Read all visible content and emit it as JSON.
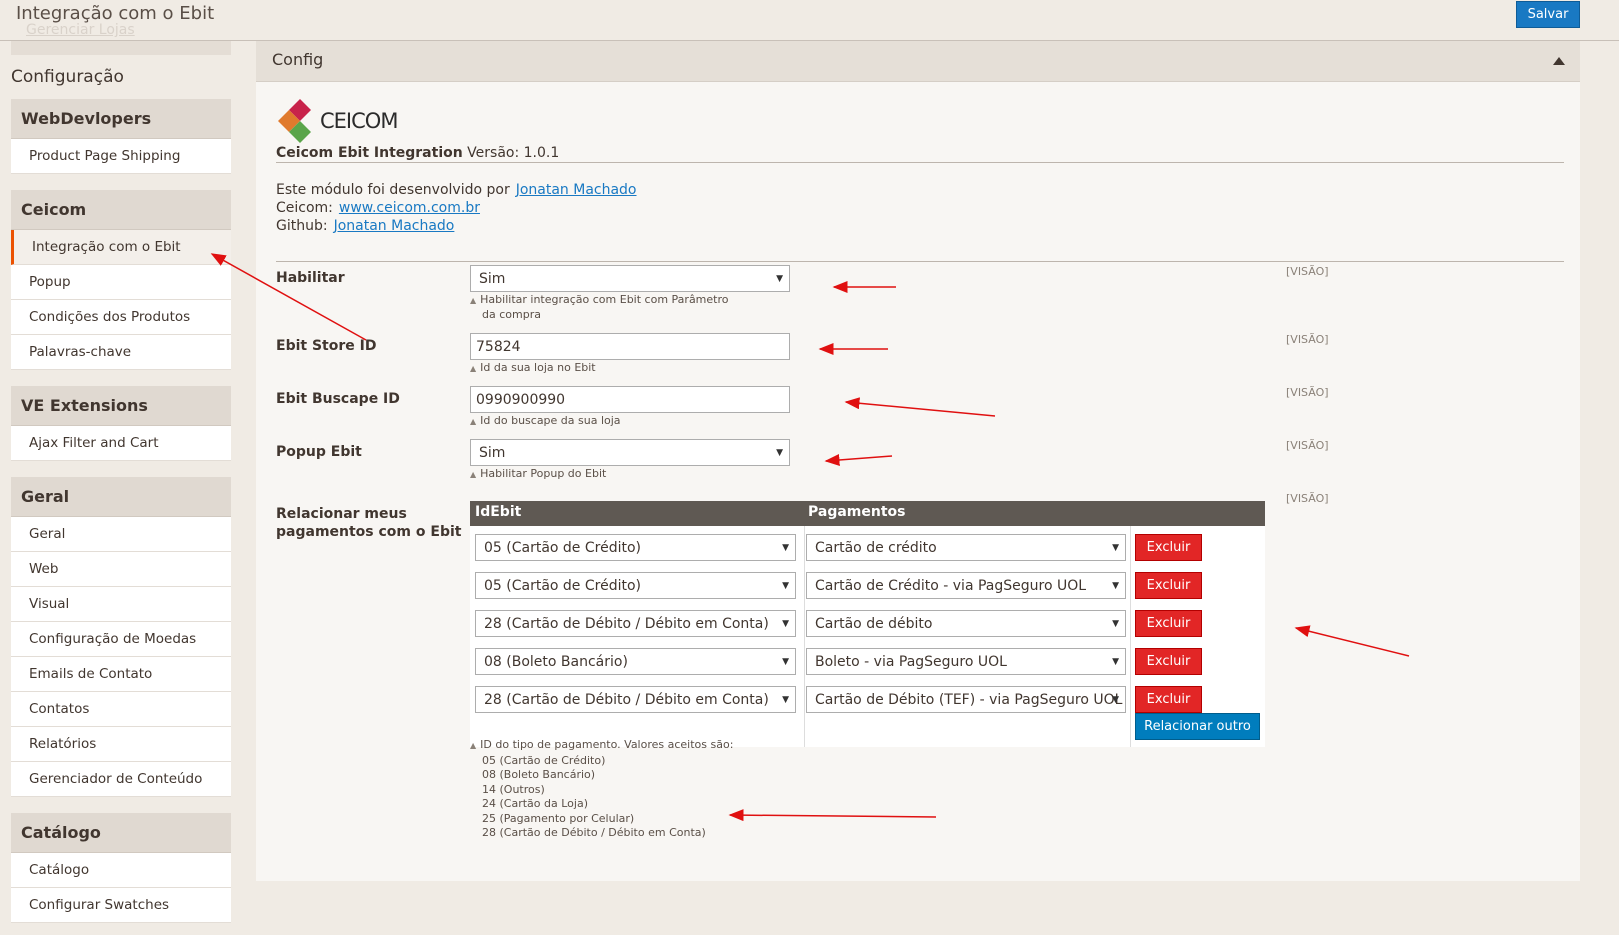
{
  "header": {
    "title": "Integração com o Ebit",
    "ghost_text": "Gerenciar Lojas",
    "save_label": "Salvar"
  },
  "sidebar": {
    "heading": "Configuração",
    "sections": [
      {
        "title": "WebDevlopers",
        "items": [
          "Product Page Shipping"
        ]
      },
      {
        "title": "Ceicom",
        "items": [
          "Integração com o Ebit",
          "Popup",
          "Condições dos Produtos",
          "Palavras-chave"
        ],
        "active": 0
      },
      {
        "title": "VE Extensions",
        "items": [
          "Ajax Filter and Cart"
        ]
      },
      {
        "title": "Geral",
        "items": [
          "Geral",
          "Web",
          "Visual",
          "Configuração de Moedas",
          "Emails de Contato",
          "Contatos",
          "Relatórios",
          "Gerenciador de Conteúdo"
        ]
      },
      {
        "title": "Catálogo",
        "items": [
          "Catálogo",
          "Configurar Swatches"
        ]
      }
    ]
  },
  "panel": {
    "title": "Config",
    "logo_text": "CEICOM",
    "module_name": "Ceicom Ebit Integration",
    "version_text": " Versão: 1.0.1",
    "dev_text": "Este módulo foi desenvolvido por",
    "dev_link": "Jonatan Machado",
    "ceicom_label": "Ceicom:",
    "ceicom_link": "www.ceicom.com.br",
    "github_label": "Github:",
    "github_link": "Jonatan Machado"
  },
  "fields": {
    "habilitar": {
      "label": "Habilitar",
      "value": "Sim",
      "note_1": "Habilitar integração com Ebit com Parâmetro",
      "note_2": "da compra",
      "scope": "[VISÃO]"
    },
    "store_id": {
      "label": "Ebit Store ID",
      "value": "75824",
      "note": "Id da sua loja no Ebit",
      "scope": "[VISÃO]"
    },
    "buscape_id": {
      "label": "Ebit Buscape ID",
      "value": "0990900990",
      "note": "Id do buscape da sua loja",
      "scope": "[VISÃO]"
    },
    "popup": {
      "label": "Popup Ebit",
      "value": "Sim",
      "note": "Habilitar Popup do Ebit",
      "scope": "[VISÃO]"
    },
    "relacionar": {
      "label_1": "Relacionar meus",
      "label_2": "pagamentos com o Ebit",
      "scope": "[VISÃO]"
    }
  },
  "mapping": {
    "col_idebit": "IdEbit",
    "col_pagamentos": "Pagamentos",
    "rows": [
      {
        "idebit": "05 (Cartão de Crédito)",
        "pagamento": "Cartão de crédito",
        "delete": "Excluir"
      },
      {
        "idebit": "05 (Cartão de Crédito)",
        "pagamento": "Cartão de Crédito - via PagSeguro UOL",
        "delete": "Excluir"
      },
      {
        "idebit": "28 (Cartão de Débito / Débito em Conta)",
        "pagamento": "Cartão de débito",
        "delete": "Excluir"
      },
      {
        "idebit": "08 (Boleto Bancário)",
        "pagamento": "Boleto - via PagSeguro UOL",
        "delete": "Excluir"
      },
      {
        "idebit": "28 (Cartão de Débito / Débito em Conta)",
        "pagamento": "Cartão de Débito (TEF) - via PagSeguro UOL",
        "delete": "Excluir"
      }
    ],
    "add_label": "Relacionar outro",
    "valid_title": "ID do tipo de pagamento. Valores aceitos são:",
    "valid_values": [
      "05 (Cartão de Crédito)",
      "08 (Boleto Bancário)",
      "14 (Outros)",
      "24 (Cartão da Loja)",
      "25 (Pagamento por Celular)",
      "28 (Cartão de Débito / Débito em Conta)"
    ]
  },
  "colors": {
    "accent": "#eb5202",
    "primary_button": "#1979c3",
    "delete_button": "#e22626",
    "annotation_arrow": "#e01010"
  }
}
